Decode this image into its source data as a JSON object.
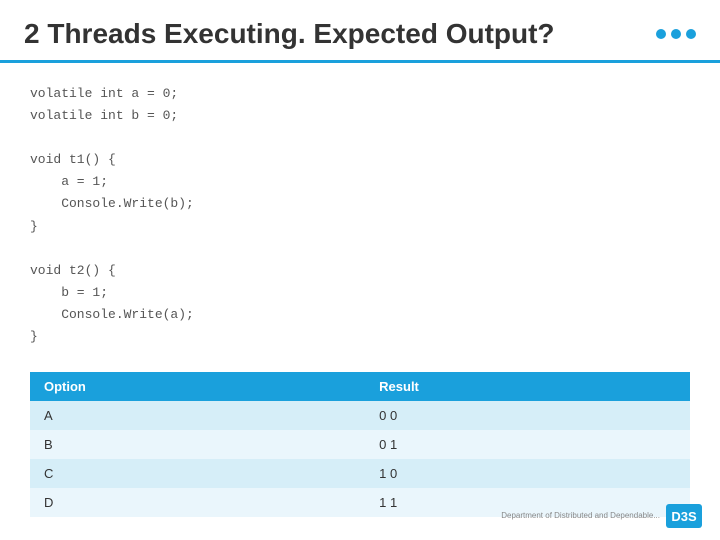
{
  "title": "2 Threads Executing. Expected Output?",
  "dots": [
    "dot1",
    "dot2",
    "dot3"
  ],
  "code": {
    "lines": [
      "volatile int a = 0;",
      "volatile int b = 0;",
      "",
      "void t1() {",
      "    a = 1;",
      "    Console.Write(b);",
      "}",
      "",
      "void t2() {",
      "    b = 1;",
      "    Console.Write(a);",
      "}"
    ]
  },
  "table": {
    "headers": [
      "Option",
      "Result"
    ],
    "rows": [
      {
        "option": "A",
        "result": "0 0"
      },
      {
        "option": "B",
        "result": "0 1"
      },
      {
        "option": "C",
        "result": "1 0"
      },
      {
        "option": "D",
        "result": "1 1"
      }
    ]
  },
  "footer": {
    "text": "Department of\nDistributed and\nDependable...",
    "logo": "D3S"
  }
}
